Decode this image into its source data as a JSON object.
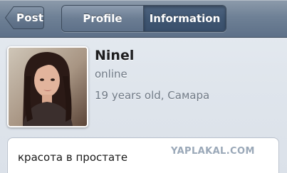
{
  "navbar": {
    "back_label": "Post",
    "tabs": [
      {
        "label": "Profile",
        "selected": false
      },
      {
        "label": "Information",
        "selected": true
      }
    ]
  },
  "profile": {
    "name": "Ninel",
    "status": "online",
    "age_location": "19 years old, Самара"
  },
  "status_message": {
    "text": "красота в простате"
  },
  "watermark": "YAPLAKAL.COM",
  "colors": {
    "navbar": "#6f8196",
    "selected_tab": "#3f5672",
    "secondary_text": "#707a86",
    "background": "#e3e8ef"
  }
}
